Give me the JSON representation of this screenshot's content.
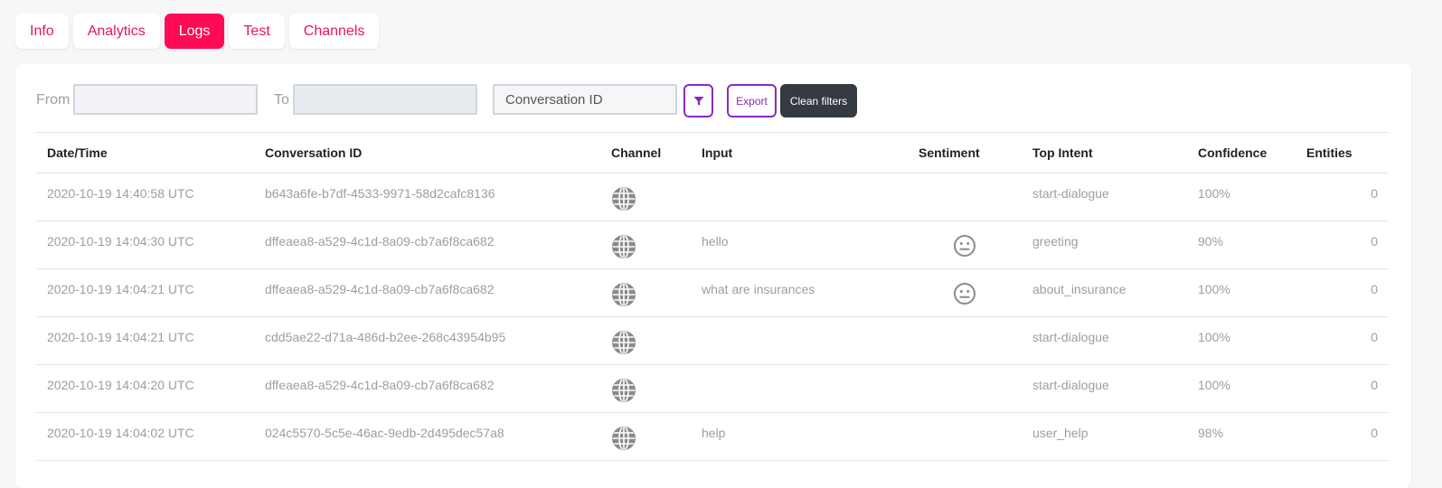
{
  "tabs": [
    {
      "label": "Info",
      "active": false
    },
    {
      "label": "Analytics",
      "active": false
    },
    {
      "label": "Logs",
      "active": true
    },
    {
      "label": "Test",
      "active": false
    },
    {
      "label": "Channels",
      "active": false
    }
  ],
  "filters": {
    "from_label": "From",
    "from_value": "",
    "to_label": "To",
    "to_value": "",
    "conversation_placeholder": "Conversation ID",
    "filter_icon": "funnel-icon",
    "export_label": "Export",
    "clean_label": "Clean filters"
  },
  "colors": {
    "accent": "#ff0a53",
    "tab_text": "#e8155b",
    "button_purple": "#8a2ac0",
    "dark_button": "#343a40"
  },
  "table": {
    "columns": [
      "Date/Time",
      "Conversation ID",
      "Channel",
      "Input",
      "Sentiment",
      "Top Intent",
      "Confidence",
      "Entities"
    ],
    "rows": [
      {
        "datetime": "2020-10-19 14:40:58 UTC",
        "conversation_id": "b643a6fe-b7df-4533-9971-58d2cafc8136",
        "channel_icon": "globe-icon",
        "input": "",
        "sentiment_icon": "",
        "top_intent": "start-dialogue",
        "confidence": "100%",
        "entities": "0"
      },
      {
        "datetime": "2020-10-19 14:04:30 UTC",
        "conversation_id": "dffeaea8-a529-4c1d-8a09-cb7a6f8ca682",
        "channel_icon": "globe-icon",
        "input": "hello",
        "sentiment_icon": "neutral-face-icon",
        "top_intent": "greeting",
        "confidence": "90%",
        "entities": "0"
      },
      {
        "datetime": "2020-10-19 14:04:21 UTC",
        "conversation_id": "dffeaea8-a529-4c1d-8a09-cb7a6f8ca682",
        "channel_icon": "globe-icon",
        "input": "what are insurances",
        "sentiment_icon": "neutral-face-icon",
        "top_intent": "about_insurance",
        "confidence": "100%",
        "entities": "0"
      },
      {
        "datetime": "2020-10-19 14:04:21 UTC",
        "conversation_id": "cdd5ae22-d71a-486d-b2ee-268c43954b95",
        "channel_icon": "globe-icon",
        "input": "",
        "sentiment_icon": "",
        "top_intent": "start-dialogue",
        "confidence": "100%",
        "entities": "0"
      },
      {
        "datetime": "2020-10-19 14:04:20 UTC",
        "conversation_id": "dffeaea8-a529-4c1d-8a09-cb7a6f8ca682",
        "channel_icon": "globe-icon",
        "input": "",
        "sentiment_icon": "",
        "top_intent": "start-dialogue",
        "confidence": "100%",
        "entities": "0"
      },
      {
        "datetime": "2020-10-19 14:04:02 UTC",
        "conversation_id": "024c5570-5c5e-46ac-9edb-2d495dec57a8",
        "channel_icon": "globe-icon",
        "input": "help",
        "sentiment_icon": "",
        "top_intent": "user_help",
        "confidence": "98%",
        "entities": "0"
      }
    ]
  }
}
